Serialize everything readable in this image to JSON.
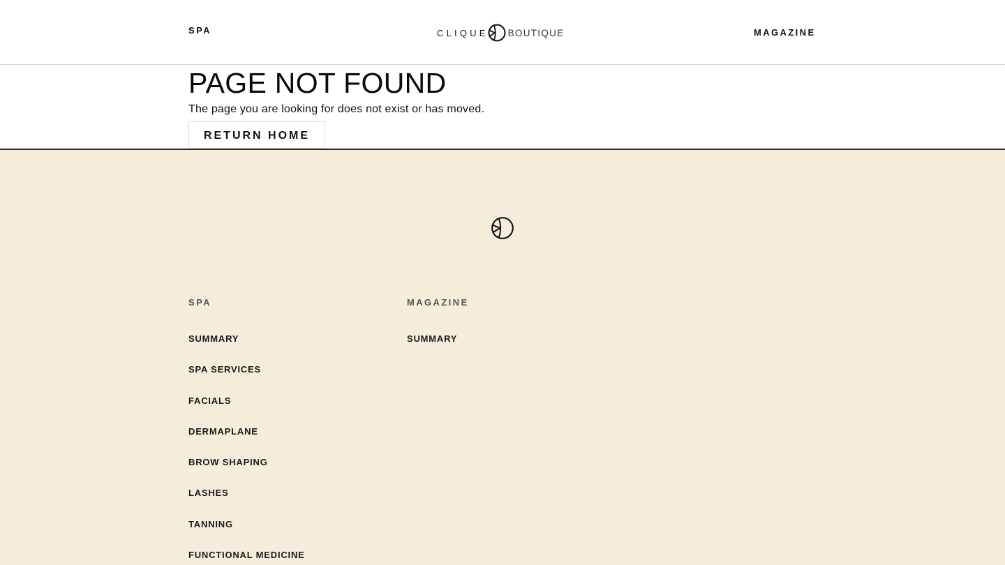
{
  "header": {
    "nav_left": "SPA",
    "nav_right": "MAGAZINE",
    "logo": {
      "word1": "CLIQUE",
      "word2": "BOUTIQUE",
      "mark_icon": "ck-monogram-icon"
    }
  },
  "main": {
    "title": "PAGE NOT FOUND",
    "message": "The page you are looking for does not exist or has moved.",
    "return_button": "RETURN HOME"
  },
  "footer": {
    "mark_icon": "ck-monogram-icon",
    "background": "#f6ecdc",
    "columns": [
      {
        "heading": "SPA",
        "links": [
          "SUMMARY",
          "SPA SERVICES",
          "FACIALS",
          "DERMAPLANE",
          "BROW SHAPING",
          "LASHES",
          "TANNING",
          "FUNCTIONAL MEDICINE"
        ]
      },
      {
        "heading": "MAGAZINE",
        "links": [
          "SUMMARY"
        ]
      }
    ]
  }
}
